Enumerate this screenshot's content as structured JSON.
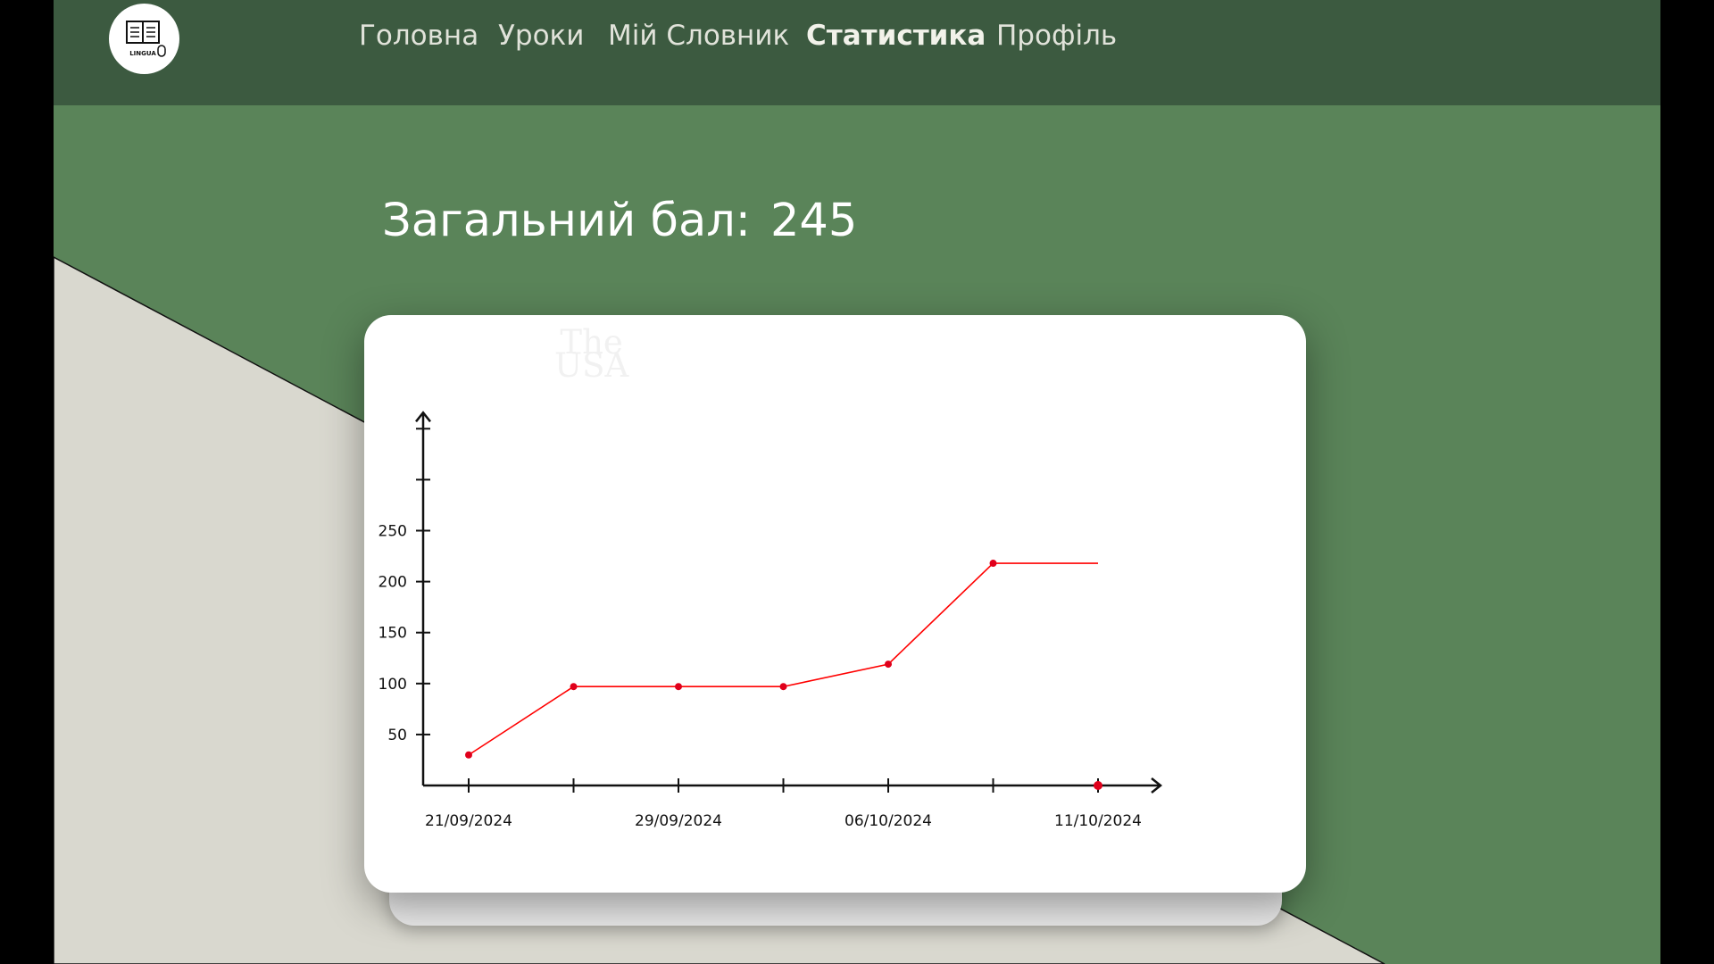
{
  "nav": {
    "logo_text": "LINGUA",
    "items": [
      {
        "label": "Головна",
        "active": false
      },
      {
        "label": "Уроки",
        "active": false
      },
      {
        "label": "Мій Словник",
        "active": false
      },
      {
        "label": "Статистика",
        "active": true
      },
      {
        "label": "Профіль",
        "active": false
      }
    ]
  },
  "score": {
    "label": "Загальний бал:",
    "value": "245"
  },
  "watermark": {
    "line1": "The",
    "line2": "USA"
  },
  "colors": {
    "navbar": "#3c5a40",
    "background": "#5a8459",
    "beige_panel": "#d9d8cf",
    "line": "#ff0000",
    "point": "#e0001b",
    "card": "#ffffff"
  },
  "chart_data": {
    "type": "line",
    "x": [
      "21/09/2024",
      "",
      "29/09/2024",
      "",
      "06/10/2024",
      "",
      "11/10/2024"
    ],
    "x_tick_labels": [
      "21/09/2024",
      "29/09/2024",
      "06/10/2024",
      "11/10/2024"
    ],
    "y_ticks": [
      50,
      100,
      150,
      200,
      250
    ],
    "ylim": [
      0,
      350
    ],
    "series": [
      {
        "values": [
          30,
          97,
          97,
          97,
          119,
          218,
          218
        ]
      }
    ],
    "grid": false
  }
}
